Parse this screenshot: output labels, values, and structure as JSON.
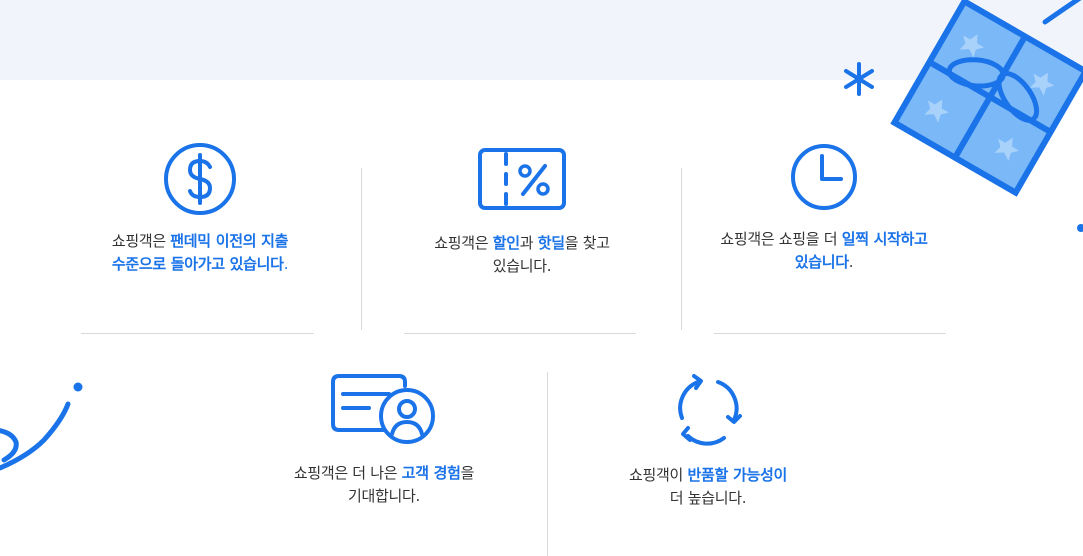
{
  "colors": {
    "accent": "#1a73e8",
    "text": "#333333",
    "band": "#f1f5fb",
    "gift_fill": "#7bb8f7",
    "divider": "#d9d9d9"
  },
  "features": [
    {
      "icon": "dollar-icon",
      "line1_pre": "쇼핑객은 ",
      "line1_hl": "팬데믹 이전의 지출",
      "line2_hl": "수준으로 돌아가고 있습니다",
      "line2_post": "."
    },
    {
      "icon": "coupon-percent-icon",
      "line1_pre": "쇼핑객은 ",
      "line1_hl1": "할인",
      "line1_mid": "과 ",
      "line1_hl2": "핫딜",
      "line1_post": "을 찾고",
      "line2": "있습니다."
    },
    {
      "icon": "clock-icon",
      "line1_pre": "쇼핑객은 쇼핑을 더 ",
      "line1_hl": "일찍 시작하고",
      "line2_hl": "있습니다",
      "line2_post": "."
    },
    {
      "icon": "customer-card-icon",
      "line1_pre": "쇼핑객은 더 나은 ",
      "line1_hl": "고객 경험",
      "line1_post": "을",
      "line2": "기대합니다."
    },
    {
      "icon": "refresh-cycle-icon",
      "line1_pre": "쇼핑객이 ",
      "line1_hl": "반품할 가능성이",
      "line2": "더 높습니다."
    }
  ]
}
